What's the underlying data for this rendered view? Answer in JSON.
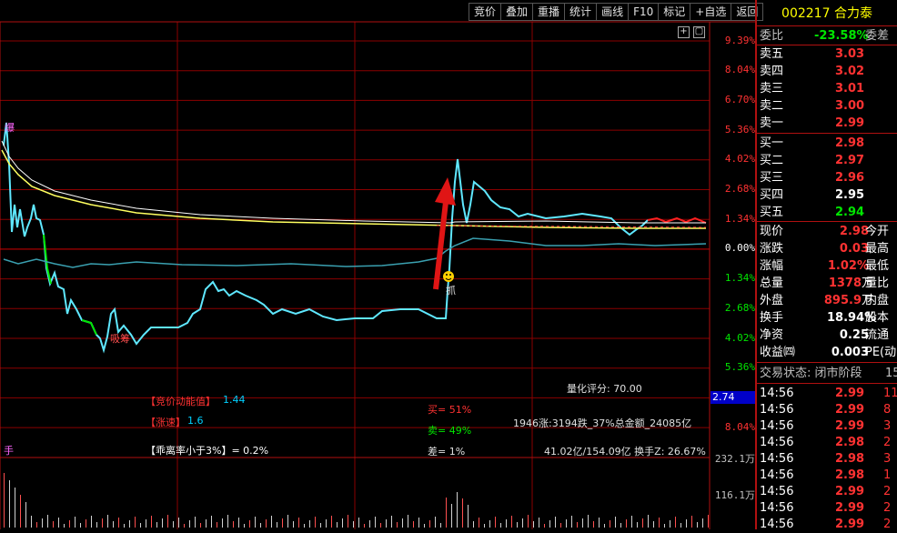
{
  "toolbar": {
    "buttons": [
      "竞价",
      "叠加",
      "重播",
      "统计",
      "画线",
      "F10",
      "标记",
      "+自选",
      "返回"
    ]
  },
  "stock": {
    "code": "002217",
    "name": "合力泰"
  },
  "price_axis": {
    "right_labels": [
      "9.39%",
      "8.04%",
      "6.70%",
      "5.36%",
      "4.02%",
      "2.68%",
      "1.34%",
      "0.00%",
      "1.34%",
      "2.68%",
      "4.02%",
      "5.36%"
    ],
    "cursor_value": "2.74"
  },
  "volume_axis": {
    "labels": [
      "232.1万",
      "116.1万"
    ]
  },
  "chart_marks": {
    "top_tag": "爆",
    "buy_tag": "抓",
    "low_tag": "吸筹",
    "vol_tag": "手"
  },
  "indicators": {
    "quant_score": "量化评分: 70.00",
    "auction_energy_label": "【竞价动能值】",
    "auction_energy_value": "1.44",
    "speed_label": "【涨速】",
    "speed_value": "1.6",
    "deviation": "【乖离率小于3%】= 0.2%",
    "buy_pct": "买= 51%",
    "sell_pct": "卖= 49%",
    "diff_pct": "差= 1%",
    "market_breadth": "1946涨:3194跌_37%总金额_24085亿",
    "turnover_info": "41.02亿/154.09亿  换手Z: 26.67%"
  },
  "order_book": {
    "weibi_label": "委比",
    "weibi_value": "-23.58%",
    "weicha_label": "委差",
    "sells": [
      {
        "label": "卖五",
        "price": "3.03"
      },
      {
        "label": "卖四",
        "price": "3.02"
      },
      {
        "label": "卖三",
        "price": "3.01"
      },
      {
        "label": "卖二",
        "price": "3.00"
      },
      {
        "label": "卖一",
        "price": "2.99"
      }
    ],
    "buys": [
      {
        "label": "买一",
        "price": "2.98"
      },
      {
        "label": "买二",
        "price": "2.97"
      },
      {
        "label": "买三",
        "price": "2.96"
      },
      {
        "label": "买四",
        "price": "2.95"
      },
      {
        "label": "买五",
        "price": "2.94"
      }
    ]
  },
  "stats": [
    {
      "label": "现价",
      "value": "2.98",
      "label2": "今开"
    },
    {
      "label": "涨跌",
      "value": "0.03",
      "label2": "最高"
    },
    {
      "label": "涨幅",
      "value": "1.02%",
      "label2": "最低"
    },
    {
      "label": "总量",
      "value": "1378",
      "unit": "万",
      "label2": "量比"
    },
    {
      "label": "外盘",
      "value": "895.9",
      "unit": "万",
      "label2": "内盘"
    },
    {
      "label": "换手",
      "value": "18.94%",
      "label2": "股本"
    },
    {
      "label": "净资",
      "value": "0.25",
      "label2": "流通"
    },
    {
      "label": "收益㈣",
      "value": "0.003",
      "label2": "PE(动"
    }
  ],
  "trade_status": "交易状态: 闭市阶段",
  "trade_status_extra": "15",
  "ticks": [
    {
      "time": "14:56",
      "price": "2.99",
      "vol": "11"
    },
    {
      "time": "14:56",
      "price": "2.99",
      "vol": "8"
    },
    {
      "time": "14:56",
      "price": "2.99",
      "vol": "3"
    },
    {
      "time": "14:56",
      "price": "2.98",
      "vol": "2"
    },
    {
      "time": "14:56",
      "price": "2.98",
      "vol": "3"
    },
    {
      "time": "14:56",
      "price": "2.98",
      "vol": "1"
    },
    {
      "time": "14:56",
      "price": "2.99",
      "vol": "2"
    },
    {
      "time": "14:56",
      "price": "2.99",
      "vol": "2"
    },
    {
      "time": "14:56",
      "price": "2.99",
      "vol": "2"
    }
  ],
  "colors": {
    "price_line": "#5fe8ff",
    "avg_line": "#ffff60",
    "grid": "#8b0000",
    "up": "#ff3232",
    "down": "#00e600",
    "arrow": "#e01515"
  }
}
